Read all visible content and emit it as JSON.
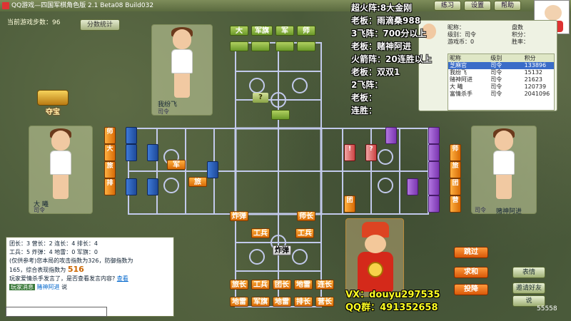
{
  "window": {
    "title": "QQ游戏—四国军棋角色版 2.1 Beta08 Build032"
  },
  "topbar": {
    "btn1": "练习",
    "btn2": "设置",
    "btn3": "帮助"
  },
  "game": {
    "steps_label": "当前游戏步数：96",
    "stats_btn": "分数统计"
  },
  "treasure": {
    "label": "夺宝",
    "badge": "哦"
  },
  "players": {
    "top": {
      "name": "我纷飞",
      "rank": "司令"
    },
    "left": {
      "name": "大 曦",
      "rank": "司令"
    },
    "right": {
      "name": "赌神阿进",
      "rank": "司令"
    }
  },
  "overlay": {
    "lines": [
      "超火阵:8大金刚",
      "老板：雨滴桑988",
      "3飞阵：700分以上",
      "老板：赌神阿进",
      "火箭阵：20连胜以上",
      "老板：双双1",
      "2飞阵：",
      "老板：",
      "连胜："
    ]
  },
  "info": {
    "nick_label": "昵称：",
    "level_label": "级别：司令",
    "score_label": "积分：",
    "coins_label": "游戏币：0",
    "head_label": "盘数",
    "win_label": "胜率：",
    "cols": [
      "昵称",
      "级别",
      "积分"
    ],
    "rows": [
      {
        "nick": "芝麻官",
        "level": "司令",
        "score": "133896"
      },
      {
        "nick": "我纷飞",
        "level": "司令",
        "score": "15132"
      },
      {
        "nick": "赌神阿进",
        "level": "司令",
        "score": "21623"
      },
      {
        "nick": "大 曦",
        "level": "司令",
        "score": "120739"
      },
      {
        "nick": "富情杀手",
        "level": "司令",
        "score": "2041096"
      }
    ]
  },
  "board": {
    "top_pieces": [
      "大",
      "军旗",
      "军",
      "师"
    ],
    "top_q": "?",
    "left_pieces": [
      "师",
      "大",
      "旅",
      "排"
    ],
    "left_mid": [
      "军",
      "旅"
    ],
    "right_pieces": [
      "师",
      "旅",
      "团",
      "营"
    ],
    "purple_q1": "!",
    "purple_q2": "?",
    "right_tag": "团",
    "bottom_row1": [
      "炸弹",
      "师长"
    ],
    "bottom_row2": [
      "工兵",
      "工兵"
    ],
    "bottom_row3": [
      "炸弹"
    ],
    "bottom_row4": [
      "旅长",
      "工兵",
      "团长",
      "地雷",
      "连长"
    ],
    "bottom_row5": [
      "地雷",
      "军旗",
      "地雷",
      "排长",
      "营长"
    ]
  },
  "chat": {
    "l1": "团长：3  营长：2  连长：4  排长：4",
    "l2": "工兵：5  炸弹：4  地雷：0  军旗：0",
    "l3": "(仅供参考)您本局的攻击指数为326，防御指数为",
    "l4a": "165，综合表现指数为",
    "l4b": "516",
    "l5": "玩家爱情杀手发言了，是否查看发言内容?",
    "l5b": "查看",
    "tag1": "玩家消息",
    "tag2": "赌神阿进",
    "tag3": "说"
  },
  "actions": {
    "skip": "跳过",
    "peace": "求和",
    "surrender": "投降"
  },
  "side_btns": {
    "emote": "表情",
    "b2": "邀请好友",
    "b3": "说"
  },
  "promo": {
    "vx": "VX：douyu297535",
    "qq": "QQ群：491352658"
  },
  "room": {
    "no": "55558"
  }
}
